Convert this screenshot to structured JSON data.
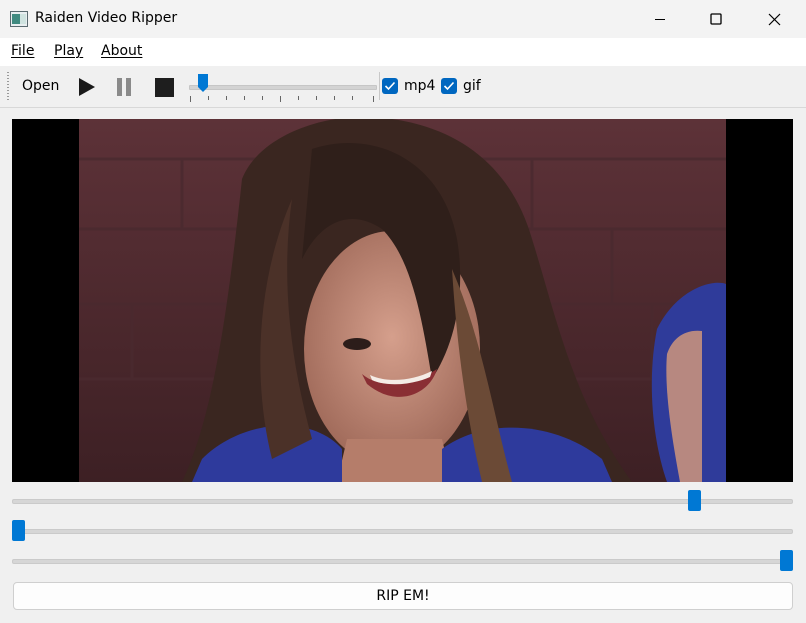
{
  "window": {
    "title": "Raiden Video Ripper",
    "controls": [
      "minimize-icon",
      "maximize-icon",
      "close-icon"
    ]
  },
  "menu": {
    "file": "File",
    "play": "Play",
    "about": "About"
  },
  "toolbar": {
    "open_label": "Open",
    "play_icon": "play-icon",
    "pause_icon": "pause-icon",
    "stop_icon": "stop-icon",
    "position_value": 0.03,
    "mp4": {
      "label": "mp4",
      "checked": true
    },
    "gif": {
      "label": "gif",
      "checked": true
    }
  },
  "sliders": {
    "slider_1_value": 0.88,
    "slider_2_value": 0.0,
    "slider_3_value": 1.0
  },
  "rip_button_label": "RIP EM!",
  "colors": {
    "accent": "#0078d4",
    "checkbox": "#0067c0",
    "window_bg": "#f0f0f0"
  }
}
